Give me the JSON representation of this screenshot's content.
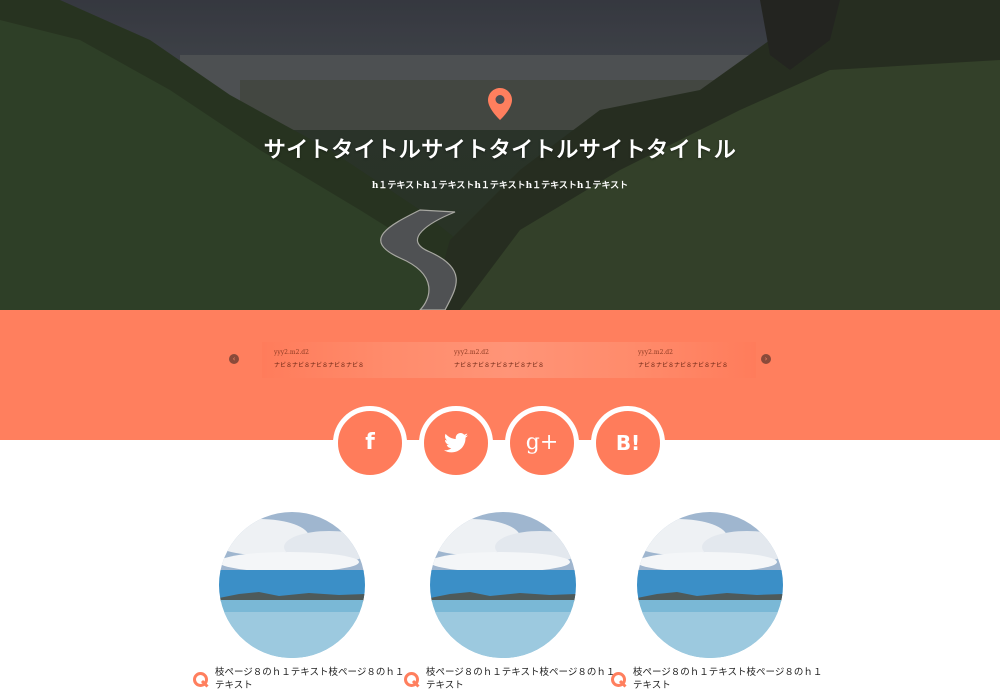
{
  "hero": {
    "title": "サイトタイトルサイトタイトルサイトタイトル",
    "subtitle": "h１テキストh１テキストh１テキストh１テキストh１テキスト",
    "pin_icon": "map-pin-icon",
    "accent": "#ff7f5e"
  },
  "slider": {
    "items": [
      {
        "domain": "yyy2.m2.d2",
        "nav": "ナビ８ナビ８ナビ８ナビ８ナビ８"
      },
      {
        "domain": "yyy2.m2.d2",
        "nav": "ナビ８ナビ８ナビ８ナビ８ナビ８"
      },
      {
        "domain": "yyy2.m2.d2",
        "nav": "ナビ８ナビ８ナビ８ナビ８ナビ８"
      }
    ],
    "prev_icon": "chevron-left-icon",
    "next_icon": "chevron-right-icon",
    "prev_glyph": "‹",
    "next_glyph": "›"
  },
  "social": [
    {
      "name": "facebook",
      "glyph": "f"
    },
    {
      "name": "twitter",
      "glyph": ""
    },
    {
      "name": "google-plus",
      "glyph": "g+"
    },
    {
      "name": "hatena-bookmark",
      "glyph": "B!"
    }
  ],
  "cards": [
    {
      "title": "枝ページ８のｈ１テキスト枝ページ８のｈ１テキスト"
    },
    {
      "title": "枝ページ８のｈ１テキスト枝ページ８のｈ１テキスト"
    },
    {
      "title": "枝ページ８のｈ１テキスト枝ページ８のｈ１テキスト"
    }
  ]
}
